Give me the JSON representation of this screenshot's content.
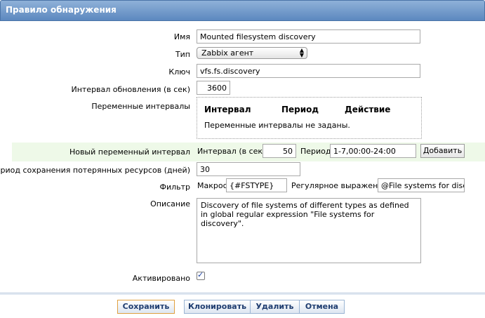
{
  "window": {
    "title": "Правило обнаружения"
  },
  "form": {
    "name_label": "Имя",
    "name_value": "Mounted filesystem discovery",
    "type_label": "Тип",
    "type_value": "Zabbix агент",
    "key_label": "Ключ",
    "key_value": "vfs.fs.discovery",
    "interval_label": "Интервал обновления (в сек)",
    "interval_value": "3600",
    "flex_label": "Переменные интервалы",
    "flex_headers": {
      "interval": "Интервал",
      "period": "Период",
      "action": "Действие"
    },
    "flex_empty": "Переменные интервалы не заданы.",
    "new_flex_label": "Новый переменный интервал",
    "new_flex_interval_label": "Интервал (в сек)",
    "new_flex_interval_value": "50",
    "new_flex_period_label": "Период",
    "new_flex_period_value": "1-7,00:00-24:00",
    "add_button": "Добавить",
    "lifetime_label": "Период сохранения потерянных ресурсов (дней)",
    "lifetime_value": "30",
    "filter_label": "Фильтр",
    "filter_macro_label": "Макрос",
    "filter_macro_value": "{#FSTYPE}",
    "filter_regexp_label": "Регулярное выражение",
    "filter_regexp_value": "@File systems for disc",
    "description_label": "Описание",
    "description_value": "Discovery of file systems of different types as defined in global regular expression \"File systems for discovery\".",
    "enabled_label": "Активировано",
    "enabled_checked": true
  },
  "buttons": {
    "save": "Сохранить",
    "clone": "Клонировать",
    "delete": "Удалить",
    "cancel": "Отмена"
  },
  "colors": {
    "title_bar": "#6e98c9",
    "highlight_row": "#eef9e8",
    "button_text": "#1f3d70",
    "save_border": "#e0a040"
  }
}
